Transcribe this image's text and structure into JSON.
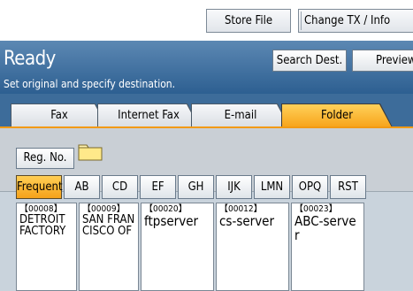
{
  "toolbar": {
    "store_file": "Store File",
    "change_tx": "Change TX / Info"
  },
  "status": {
    "title": "Ready",
    "subtitle": "Set original and specify destination."
  },
  "header_buttons": {
    "search_dest": "Search Dest.",
    "preview": "Preview"
  },
  "tabs": [
    {
      "label": "Fax",
      "active": false
    },
    {
      "label": "Internet Fax",
      "active": false
    },
    {
      "label": "E-mail",
      "active": false
    },
    {
      "label": "Folder",
      "active": true
    }
  ],
  "reg_no": "Reg. No.",
  "index_keys": [
    {
      "label": "Frequent",
      "active": true
    },
    {
      "label": "AB",
      "active": false
    },
    {
      "label": "CD",
      "active": false
    },
    {
      "label": "EF",
      "active": false
    },
    {
      "label": "GH",
      "active": false
    },
    {
      "label": "IJK",
      "active": false
    },
    {
      "label": "LMN",
      "active": false
    },
    {
      "label": "OPQ",
      "active": false
    },
    {
      "label": "RST",
      "active": false
    }
  ],
  "destinations": [
    {
      "code": "【00008】",
      "name": "DETROIT FACTORY"
    },
    {
      "code": "【00009】",
      "name": "SAN FRANCISCO OF"
    },
    {
      "code": "【00020】",
      "name": "ftpserver"
    },
    {
      "code": "【00012】",
      "name": "cs-server"
    },
    {
      "code": "【00023】",
      "name": "ABC-server"
    }
  ],
  "colors": {
    "status_bar": "#2d5f91",
    "active_tab": "#f7a31a",
    "panel": "#c9d3dc"
  }
}
